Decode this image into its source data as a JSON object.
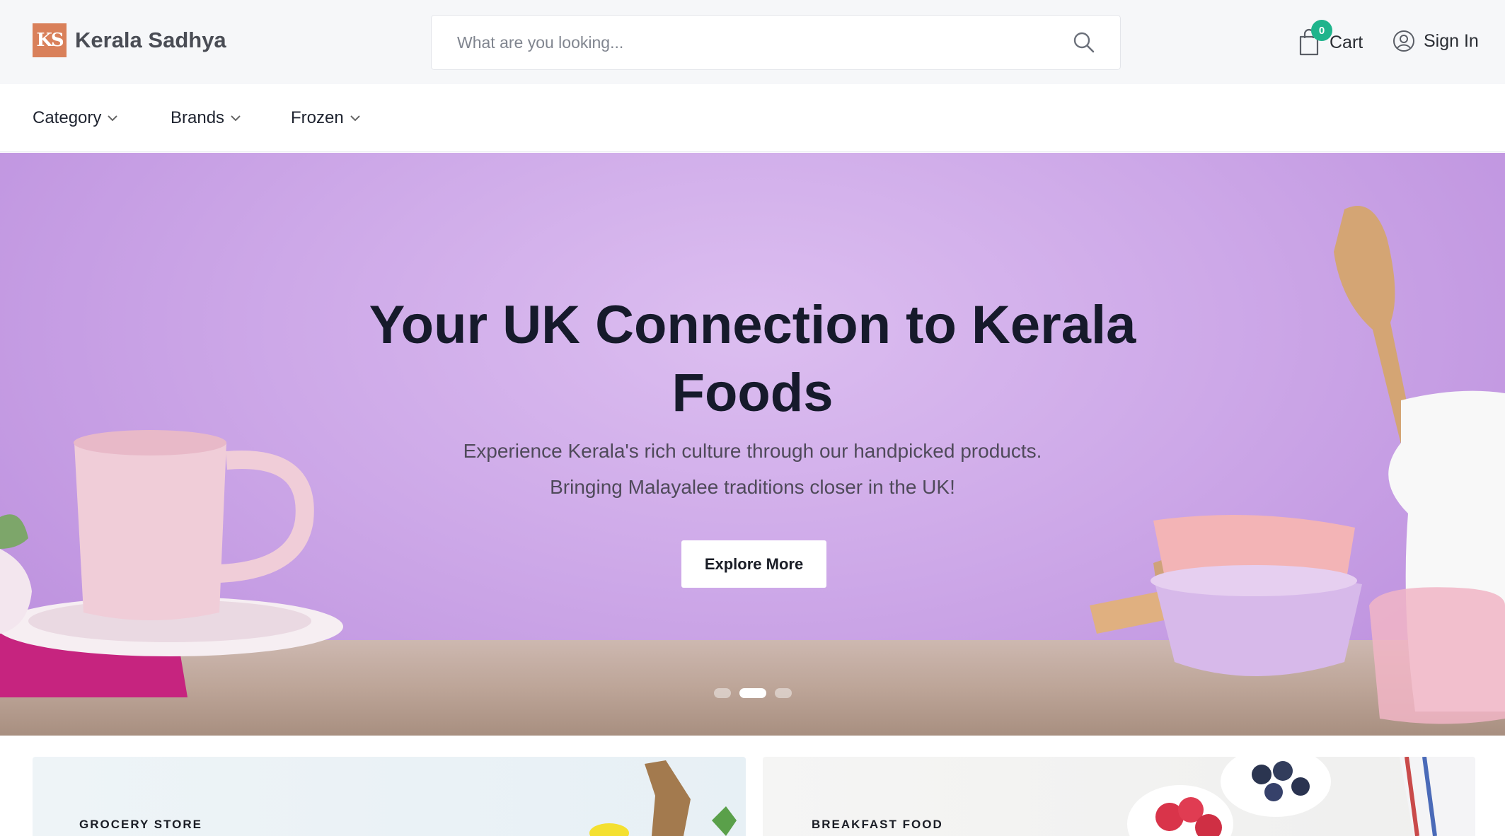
{
  "brand": {
    "logo_text": "KS",
    "name": "Kerala Sadhya"
  },
  "search": {
    "placeholder": "What are you looking..."
  },
  "cart": {
    "count": "0",
    "label": "Cart"
  },
  "account": {
    "label": "Sign In"
  },
  "nav": {
    "items": [
      {
        "label": "Category"
      },
      {
        "label": "Brands"
      },
      {
        "label": "Frozen"
      }
    ]
  },
  "hero": {
    "title_line1": "Your UK Connection to Kerala",
    "title_line2": "Foods",
    "subtitle_line1": "Experience Kerala's rich culture through our handpicked products.",
    "subtitle_line2": "Bringing Malayalee traditions closer in the UK!",
    "cta_label": "Explore More",
    "slides": 3,
    "active_slide": 2
  },
  "cards": [
    {
      "label": "GROCERY STORE"
    },
    {
      "label": "BREAKFAST FOOD"
    }
  ],
  "colors": {
    "accent_badge": "#1fb48c",
    "logo_bg": "#d9805a",
    "hero_bg": "#cda8e8"
  }
}
